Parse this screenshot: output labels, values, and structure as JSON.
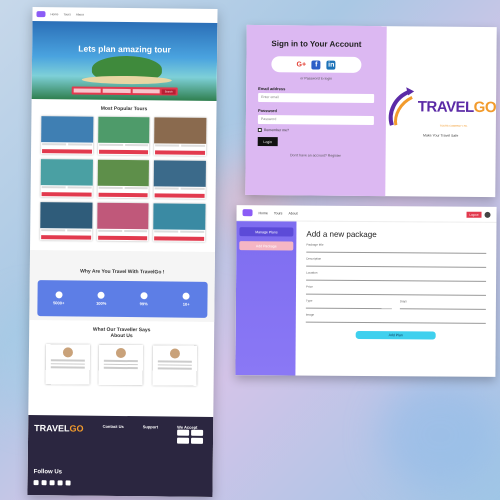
{
  "landing": {
    "hero_title": "Lets plan amazing tour",
    "search_button": "Search",
    "popular_title": "Most Popular Tours",
    "why_title": "Why Are You Travel With TravelGo !",
    "stats": [
      "5000+",
      "100%",
      "99%",
      "10+"
    ],
    "testimonial_title_1": "What Our Traveller Says",
    "testimonial_title_2": "About Us",
    "footer": {
      "brand_a": "TRAVEL",
      "brand_b": "GO",
      "contact_title": "Contact Us",
      "support_title": "Support",
      "accept_title": "We Accept",
      "follow": "Follow Us"
    },
    "tour_colors": [
      "#3f7fb3",
      "#4e9b6a",
      "#8a6a4e",
      "#4aa0a3",
      "#5e8f4a",
      "#3b6a8a",
      "#2f5c7a",
      "#c0587a",
      "#3a8aa3"
    ]
  },
  "signin": {
    "title": "Sign in to Your Account",
    "note": "or Password to login",
    "email_label": "Email address",
    "email_placeholder": "Enter email",
    "password_label": "Password",
    "password_placeholder": "Password",
    "remember": "Remember me?",
    "login_button": "Login",
    "bottom_text": "Don't have an account? Register",
    "logo_a": "TRAVEL",
    "logo_b": "GO",
    "logo_sub": "TOURS COMPANY LTD.",
    "tagline": "Make Your Travel Safe"
  },
  "admin": {
    "logout": "Logout",
    "side_items": [
      "Manage Plans",
      "Add Package"
    ],
    "title": "Add a new package",
    "fields": [
      "Package title",
      "Description",
      "Location",
      "Price",
      "Type",
      "Days",
      "Image"
    ],
    "submit": "Add Plan"
  }
}
